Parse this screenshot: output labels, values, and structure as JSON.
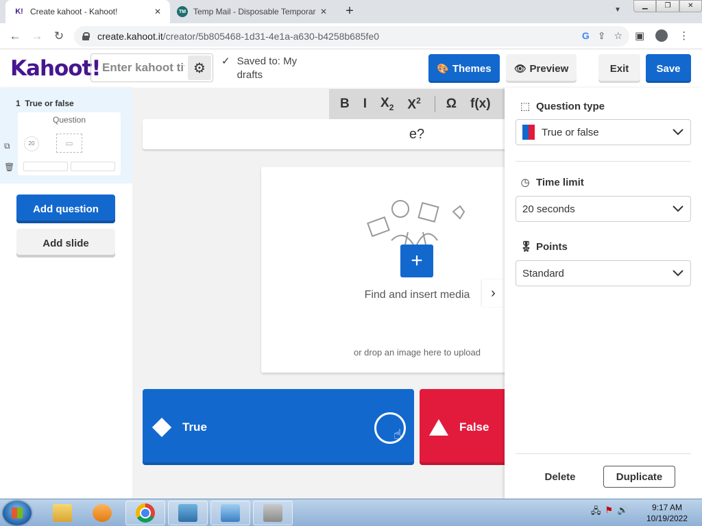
{
  "browser": {
    "tabs": [
      {
        "title": "Create kahoot - Kahoot!",
        "favicon": "K!",
        "active": true
      },
      {
        "title": "Temp Mail - Disposable Temporar",
        "favicon": "TM",
        "active": false
      }
    ],
    "url_host": "create.kahoot.it",
    "url_path": "/creator/5b805468-1d31-4e1a-a630-b4258b685fe0"
  },
  "header": {
    "logo": "Kahoot!",
    "title_placeholder": "Enter kahoot title...",
    "saved_status": "Saved to: My drafts",
    "themes_label": "Themes",
    "preview_label": "Preview",
    "exit_label": "Exit",
    "save_label": "Save"
  },
  "sidebar": {
    "slides": [
      {
        "number": "1",
        "type": "True or false",
        "thumb_title": "Question",
        "time": "20"
      }
    ],
    "add_question": "Add question",
    "add_slide": "Add slide"
  },
  "editor": {
    "toolbar": [
      "B",
      "I",
      "X",
      "X",
      "Ω",
      "f(x)"
    ],
    "toolbar_sub": "2",
    "toolbar_sup": "2",
    "question_text": "e?",
    "media_find": "Find and insert media",
    "media_drop": "or drop an image here to upload",
    "answers": [
      {
        "label": "True",
        "color": "#1368ce",
        "shape": "diamond"
      },
      {
        "label": "False",
        "color": "#e21b3c",
        "shape": "triangle"
      }
    ]
  },
  "settings": {
    "question_type_label": "Question type",
    "question_type_value": "True or false",
    "time_limit_label": "Time limit",
    "time_limit_value": "20 seconds",
    "points_label": "Points",
    "points_value": "Standard",
    "delete_label": "Delete",
    "duplicate_label": "Duplicate"
  },
  "taskbar": {
    "time": "9:17 AM",
    "date": "10/19/2022"
  },
  "colors": {
    "brand_purple": "#46178f",
    "primary_blue": "#1368ce",
    "answer_red": "#e21b3c"
  }
}
